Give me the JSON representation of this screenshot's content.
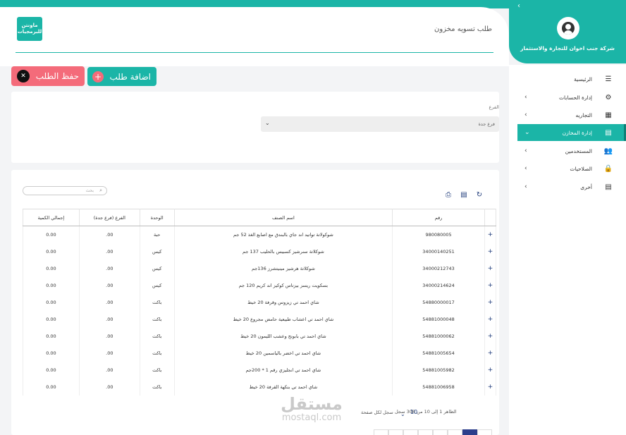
{
  "header": {
    "title": "طلب تسويه مخزون",
    "logo_text": "ماونتن للبرمجيات"
  },
  "sidebar": {
    "company": "شركة جنب اخوان للتجارة والاستثمار",
    "items": [
      {
        "label": "الرئيسية",
        "icon": "menu-icon",
        "active": false
      },
      {
        "label": "إدارة الحسابات",
        "icon": "gears-icon",
        "active": false
      },
      {
        "label": "التجاريه",
        "icon": "gift-icon",
        "active": false
      },
      {
        "label": "إدارة المخازن",
        "icon": "warehouse-icon",
        "active": true
      },
      {
        "label": "المستخدمين",
        "icon": "users-icon",
        "active": false
      },
      {
        "label": "الصلاحيات",
        "icon": "lock-icon",
        "active": false
      },
      {
        "label": "أخرى",
        "icon": "list-icon",
        "active": false
      }
    ]
  },
  "actions": {
    "save_label": "حفظ الطلب",
    "add_label": "اضافة طلب"
  },
  "branch": {
    "label": "الفرع",
    "value": "فرع جدة"
  },
  "table": {
    "search_placeholder": "بحث",
    "columns": [
      "",
      "رقم",
      "اسم الصنف",
      "الوحدة",
      "الفرع (فرع جدة)",
      "إجمالي الكمية"
    ],
    "rows": [
      {
        "code": "980080005",
        "name": "شوكولاتة تواتيد اند جاي بالبندق مع اصابع الغذ 52 جم",
        "unit": "حبة",
        "branch": ".00",
        "total": "0.00"
      },
      {
        "code": "34000140251",
        "name": "شوكلاتة سنرشيز كسبيس بالحليب 137 جم",
        "unit": "كيس",
        "branch": ".00",
        "total": "0.00"
      },
      {
        "code": "34000212743",
        "name": "شوكلاتة هرشيز مينيتشرز 136جم",
        "unit": "كيس",
        "branch": ".00",
        "total": "0.00"
      },
      {
        "code": "34000214624",
        "name": "بسكويت ريسز بيزتاس كوكيز اند كريم 120 جم",
        "unit": "كيس",
        "branch": ".00",
        "total": "0.00"
      },
      {
        "code": "54880000017",
        "name": "شاي احمد تي زيزوس وقرفة 20 خيط",
        "unit": "باكت",
        "branch": ".00",
        "total": "0.00"
      },
      {
        "code": "54881000048",
        "name": "شاي احمد تي اعشاب طبيعية حامض مجروع 20 خيط",
        "unit": "باكت",
        "branch": ".00",
        "total": "0.00"
      },
      {
        "code": "54881000062",
        "name": "شاي احمد تي بابونج وعشب الليمون 20 خيط",
        "unit": "باكت",
        "branch": ".00",
        "total": "0.00"
      },
      {
        "code": "54881005654",
        "name": "شاي احمد تي اخضر بالياسمين 20 خيط",
        "unit": "باكت",
        "branch": ".00",
        "total": "0.00"
      },
      {
        "code": "54881005982",
        "name": "شاي احمد تي انجليزي رقم 1 * 200جم",
        "unit": "باكت",
        "branch": ".00",
        "total": "0.00"
      },
      {
        "code": "54881006958",
        "name": "شاي احمد تي بنكهة القرفة 20 خيط",
        "unit": "باكت",
        "branch": ".00",
        "total": "0.00"
      }
    ]
  },
  "pagination": {
    "summary": "الظاهر 1 إلى 10 من 308 سجل",
    "page_size": "10",
    "page_size_label": "سجل لكل صفحة"
  },
  "watermark": {
    "arabic": "مستقل",
    "latin": "mostaql.com"
  },
  "colors": {
    "accent": "#1bb5a7",
    "danger": "#f46b7a",
    "navy": "#1f3b7a"
  }
}
